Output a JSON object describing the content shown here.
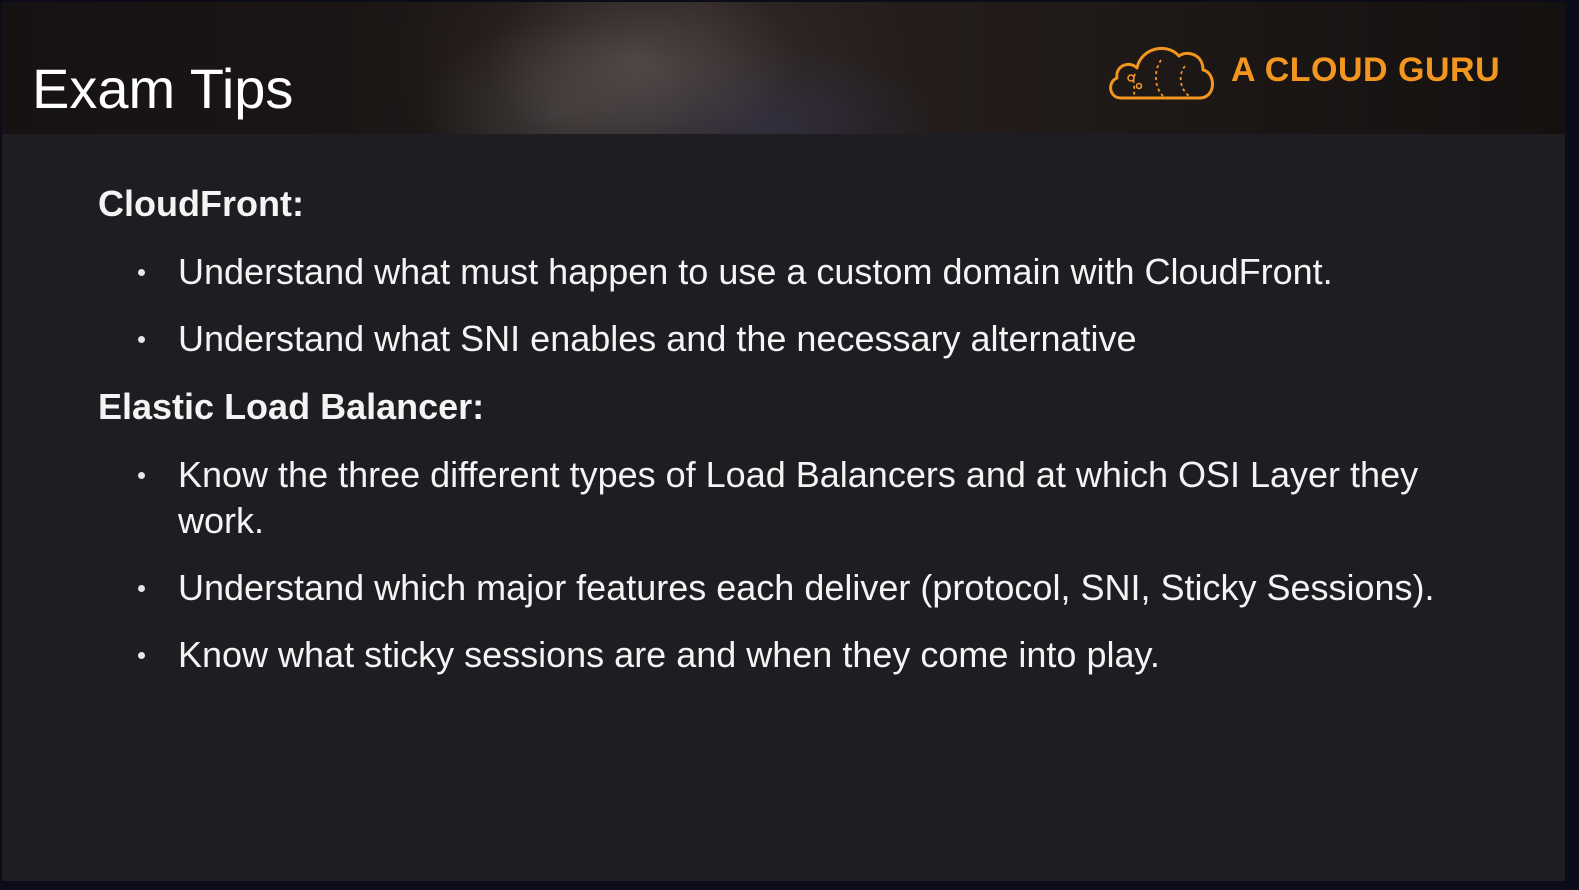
{
  "header": {
    "title": "Exam Tips",
    "brand_name": "A CLOUD GURU",
    "brand_color": "#f39620"
  },
  "sections": [
    {
      "title": "CloudFront:",
      "bullets": [
        "Understand what must happen to use a custom domain with CloudFront.",
        "Understand what SNI enables and the necessary alternative"
      ]
    },
    {
      "title": "Elastic Load Balancer:",
      "bullets": [
        "Know the three different types of Load Balancers and at which OSI Layer they work.",
        "Understand which major features each deliver (protocol, SNI, Sticky Sessions).",
        "Know what sticky sessions are and when they come into play."
      ]
    }
  ]
}
